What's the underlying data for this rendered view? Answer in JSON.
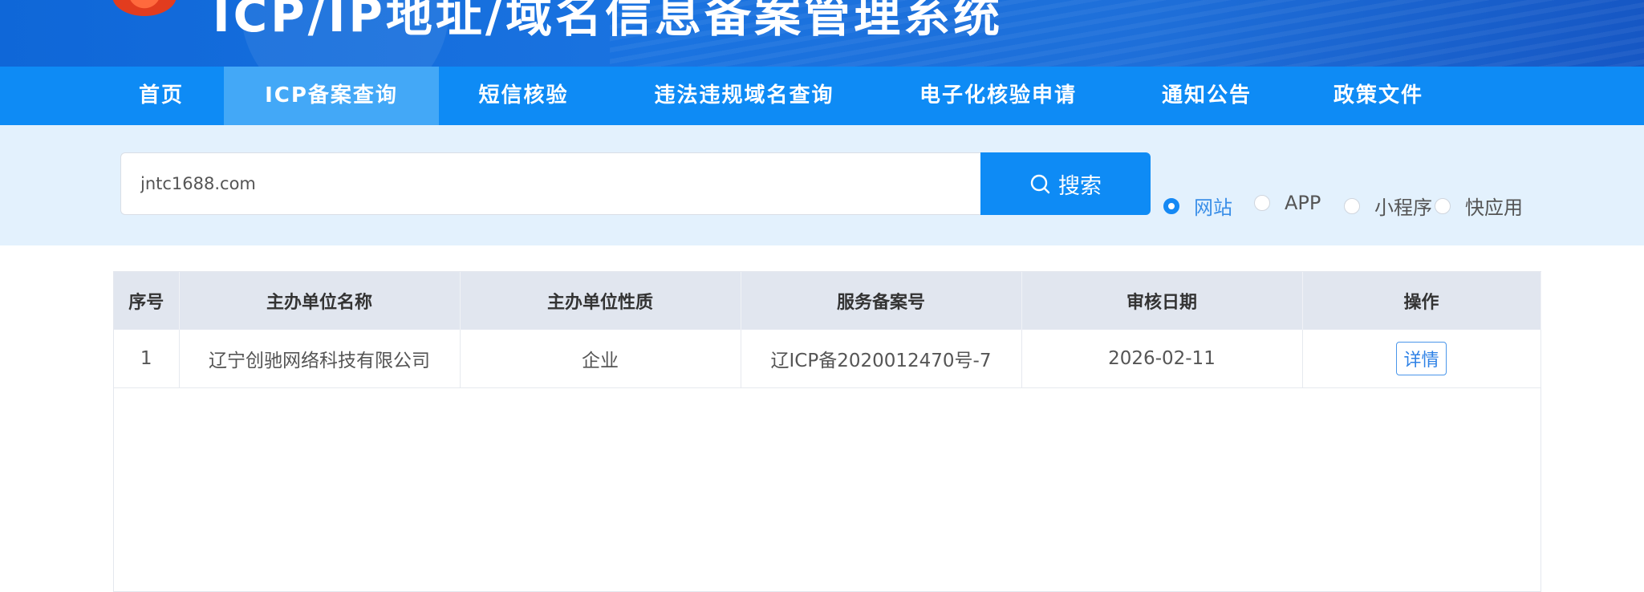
{
  "header": {
    "title": "ICP/IP地址/域名信息备案管理系统",
    "logo_icon": "emblem-icon"
  },
  "nav": {
    "items": [
      {
        "label": "首页",
        "active": false
      },
      {
        "label": "ICP备案查询",
        "active": true
      },
      {
        "label": "短信核验",
        "active": false
      },
      {
        "label": "违法违规域名查询",
        "active": false
      },
      {
        "label": "电子化核验申请",
        "active": false
      },
      {
        "label": "通知公告",
        "active": false
      },
      {
        "label": "政策文件",
        "active": false
      }
    ]
  },
  "search": {
    "value": "jntc1688.com",
    "button_label": "搜索",
    "button_icon": "search-icon",
    "types": [
      {
        "label": "网站",
        "checked": true
      },
      {
        "label": "APP",
        "checked": false
      },
      {
        "label": "小程序",
        "checked": false
      },
      {
        "label": "快应用",
        "checked": false
      }
    ]
  },
  "table": {
    "headers": [
      "序号",
      "主办单位名称",
      "主办单位性质",
      "服务备案号",
      "审核日期",
      "操作"
    ],
    "rows": [
      {
        "index": "1",
        "org_name": "辽宁创驰网络科技有限公司",
        "org_type": "企业",
        "license": "辽ICP备2020012470号-7",
        "date": "2026-02-11",
        "action": "详情"
      }
    ]
  },
  "colors": {
    "banner": "#1a73e0",
    "nav": "#0e8bf5",
    "nav_active": "#43a8f7",
    "search_band": "#e3f1fd",
    "table_header": "#e1e6ef"
  }
}
